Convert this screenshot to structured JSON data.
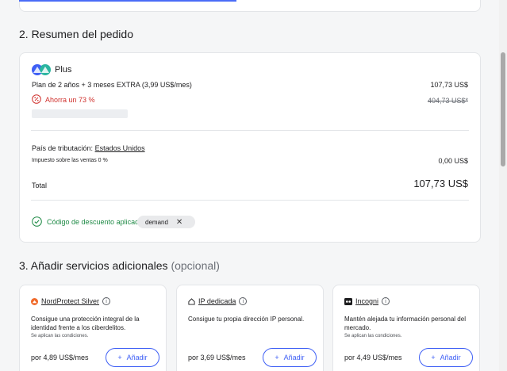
{
  "section2": {
    "title": "2. Resumen del pedido"
  },
  "order": {
    "plan_name": "Plus",
    "plan_desc": "Plan de 2 años + 3 meses EXTRA (3,99 US$/mes)",
    "plan_price": "107,73 US$",
    "saving": "Ahorra un 73 %",
    "original_price": "404,73 US$*",
    "tax_country_label": "País de tributación:",
    "tax_country": "Estados Unidos",
    "sales_tax_label": "Impuesto sobre las ventas 0 %",
    "sales_tax_value": "0,00 US$",
    "total_label": "Total",
    "total_value": "107,73 US$",
    "discount_label": "Código de descuento aplicado:",
    "discount_code": "demand"
  },
  "section3": {
    "title": "3. Añadir servicios adicionales",
    "optional": "(opcional)"
  },
  "services": [
    {
      "name": "NordProtect Silver",
      "desc": "Consigue una protección integral de la identidad frente a los ciberdelitos.",
      "cond": "Se aplican las condiciones.",
      "price": "por 4,89 US$/mes",
      "add": "Añadir"
    },
    {
      "name": "IP dedicada",
      "desc": "Consigue tu propia dirección IP personal.",
      "cond": "",
      "price": "por 3,69 US$/mes",
      "add": "Añadir"
    },
    {
      "name": "Incogni",
      "desc": "Mantén alejada tu información personal del mercado.",
      "cond": "Se aplican las condiciones.",
      "price": "por 4,49 US$/mes",
      "add": "Añadir"
    }
  ],
  "colors": {
    "accent": "#3e5ff5",
    "success": "#1f8a46",
    "danger": "#d0312d"
  }
}
